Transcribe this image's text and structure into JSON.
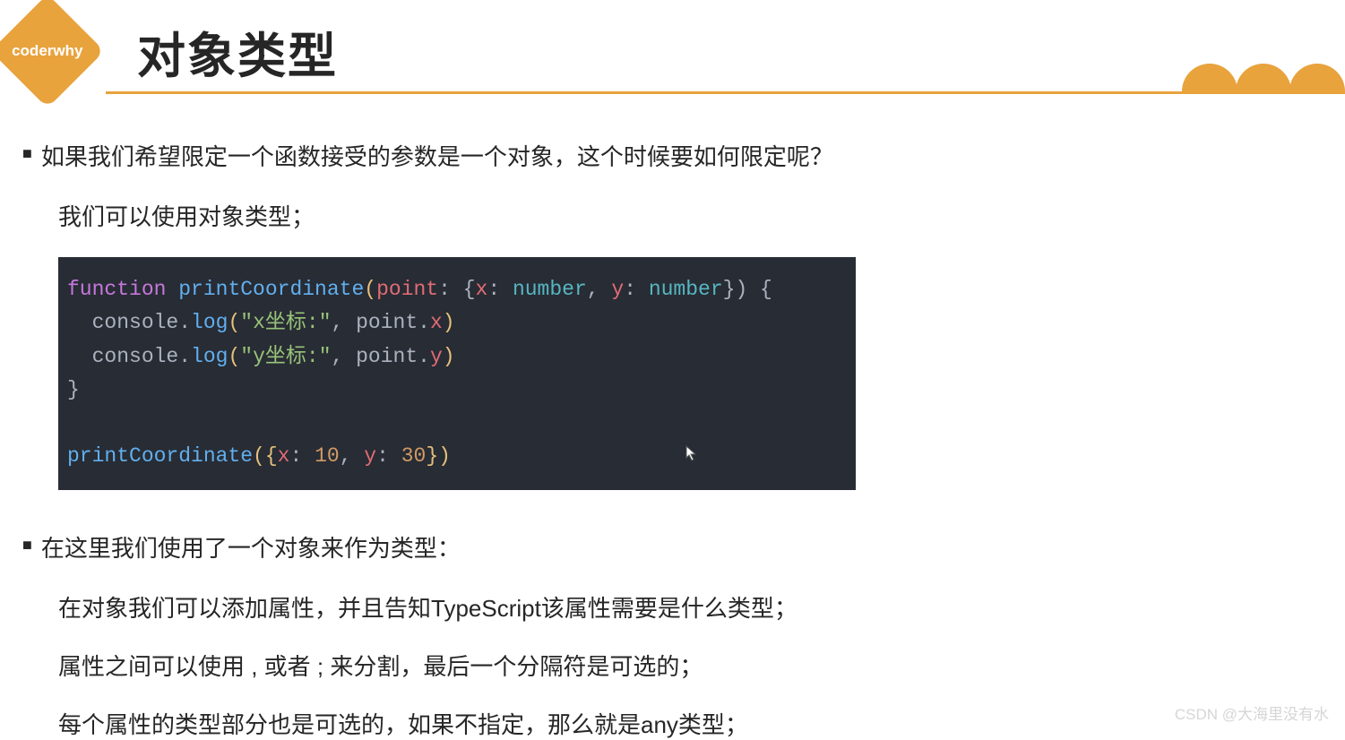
{
  "logo": "coderwhy",
  "title": "对象类型",
  "bullets": {
    "b1": "如果我们希望限定一个函数接受的参数是一个对象，这个时候要如何限定呢？",
    "b1_1": "我们可以使用对象类型；",
    "b2": "在这里我们使用了一个对象来作为类型：",
    "b2_1": "在对象我们可以添加属性，并且告知TypeScript该属性需要是什么类型；",
    "b2_2": "属性之间可以使用 , 或者 ; 来分割，最后一个分隔符是可选的；",
    "b2_3": "每个属性的类型部分也是可选的，如果不指定，那么就是any类型；"
  },
  "code": {
    "l1": {
      "kw": "function",
      "fn": "printCoordinate",
      "open": "(",
      "param": "point",
      "colon1": ": {",
      "x": "x",
      "colon2": ": ",
      "num1": "number",
      "comma": ", ",
      "y": "y",
      "colon3": ": ",
      "num2": "number",
      "close": "}) {"
    },
    "l2": {
      "obj": "console",
      "dot": ".",
      "method": "log",
      "open": "(",
      "str": "\"x坐标:\"",
      "comma": ", ",
      "p": "point",
      "dot2": ".",
      "prop": "x",
      "close": ")"
    },
    "l3": {
      "obj": "console",
      "dot": ".",
      "method": "log",
      "open": "(",
      "str": "\"y坐标:\"",
      "comma": ", ",
      "p": "point",
      "dot2": ".",
      "prop": "y",
      "close": ")"
    },
    "l4": "}",
    "l6": {
      "fn": "printCoordinate",
      "open": "({",
      "x": "x",
      "colon1": ": ",
      "v1": "10",
      "comma": ", ",
      "y": "y",
      "colon2": ": ",
      "v2": "30",
      "close": "})"
    }
  },
  "watermark": "CSDN @大海里没有水"
}
